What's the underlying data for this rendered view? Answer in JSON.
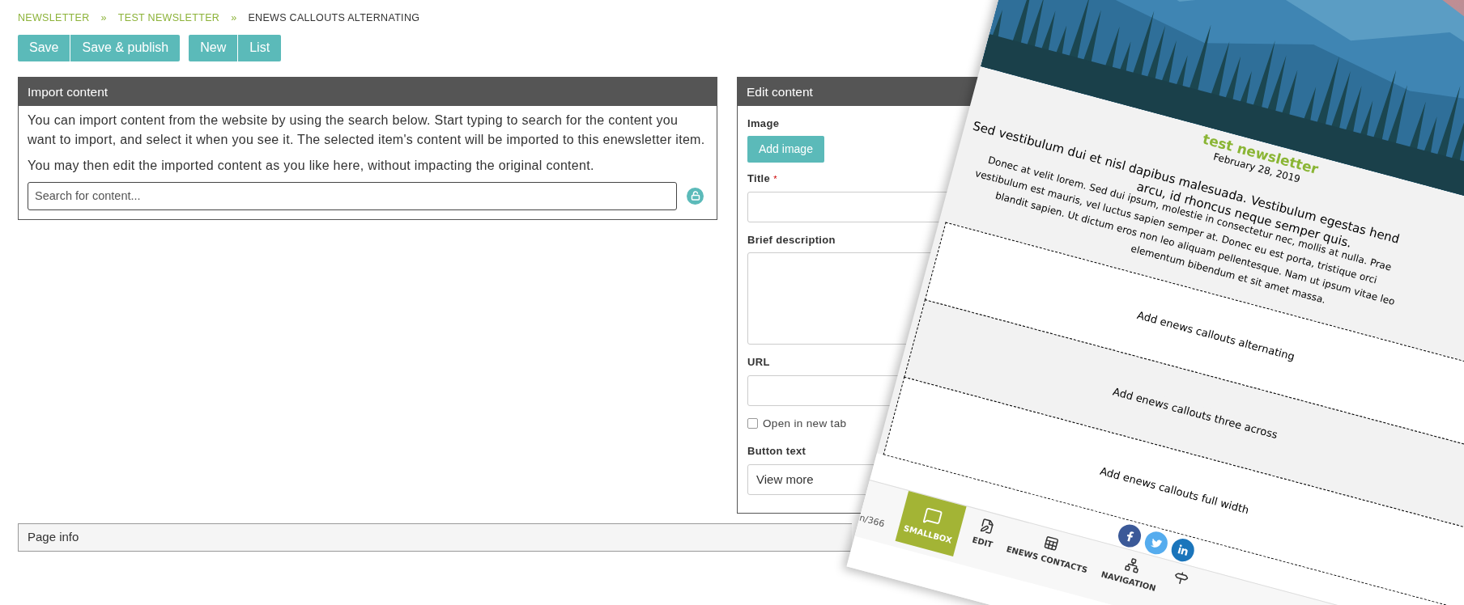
{
  "breadcrumb": [
    {
      "label": "NEWSLETTER",
      "kind": "link"
    },
    {
      "label": "»",
      "kind": "separator"
    },
    {
      "label": "TEST NEWSLETTER",
      "kind": "link"
    },
    {
      "label": "»",
      "kind": "separator"
    },
    {
      "label": "ENEWS CALLOUTS ALTERNATING",
      "kind": "current"
    }
  ],
  "toolbar": {
    "groups": [
      [
        "Save",
        "Save & publish"
      ],
      [
        "New",
        "List"
      ]
    ]
  },
  "import_panel": {
    "title": "Import content",
    "paragraphs": [
      "You can import content from the website by using the search below. Start typing to search for the content you want to import, and select it when you see it. The selected item's content will be imported to this enewsletter item.",
      "You may then edit the imported content as you like here, without impacting the original content."
    ],
    "search": {
      "placeholder": "Search for content..."
    }
  },
  "edit_panel": {
    "title": "Edit content",
    "fields": [
      {
        "label": "Image",
        "button": "Add image"
      },
      {
        "kind": "text",
        "label": "Title",
        "required_mark": "*"
      },
      {
        "kind": "textarea",
        "label": "Brief description"
      },
      {
        "kind": "text",
        "label": "URL"
      },
      {
        "kind": "checkbox",
        "label": "Open in new tab",
        "checked": false
      },
      {
        "kind": "text",
        "label": "Button text",
        "value": "View more"
      }
    ]
  },
  "page_info": {
    "title": "Page info"
  },
  "preview": {
    "title": "test newsletter",
    "date": "February 28, 2019",
    "heading_lines": [
      "Sed vestibulum dui et nisl dapibus malesuada. Vestibulum egestas hend",
      "arcu, id rhoncus neque semper quis."
    ],
    "body_lines": [
      "Donec at velit lorem. Sed dui ipsum, molestie in consectetur nec, mollis at nulla. Prae",
      "vestibulum est mauris, vel luctus sapien semper at. Donec eu est porta, tristique orci",
      "blandit sapien. Ut dictum eros non leo aliquam pellentesque. Nam ut ipsum vitae leo",
      "elementum bibendum et sit amet massa."
    ],
    "callouts": [
      {
        "label": "Add enews callouts alternating",
        "shaded": false
      },
      {
        "label": "Add enews callouts three across",
        "shaded": true
      },
      {
        "label": "Add enews callouts full width",
        "shaded": false
      }
    ],
    "social": [
      {
        "kind": "facebook",
        "color": "#3b5998"
      },
      {
        "kind": "twitter",
        "color": "#55acee"
      },
      {
        "kind": "linkedin",
        "color": "#1b75bb"
      }
    ]
  },
  "smallbox_toolbar": {
    "status_fragment": "n/366",
    "items": [
      {
        "kind": "brand",
        "label": "SMALLBOX"
      },
      {
        "kind": "edit",
        "label": "EDIT"
      },
      {
        "kind": "contacts",
        "label": "ENEWS CONTACTS"
      },
      {
        "kind": "navigation",
        "label": "NAVIGATION"
      },
      {
        "kind": "signpost"
      }
    ]
  }
}
